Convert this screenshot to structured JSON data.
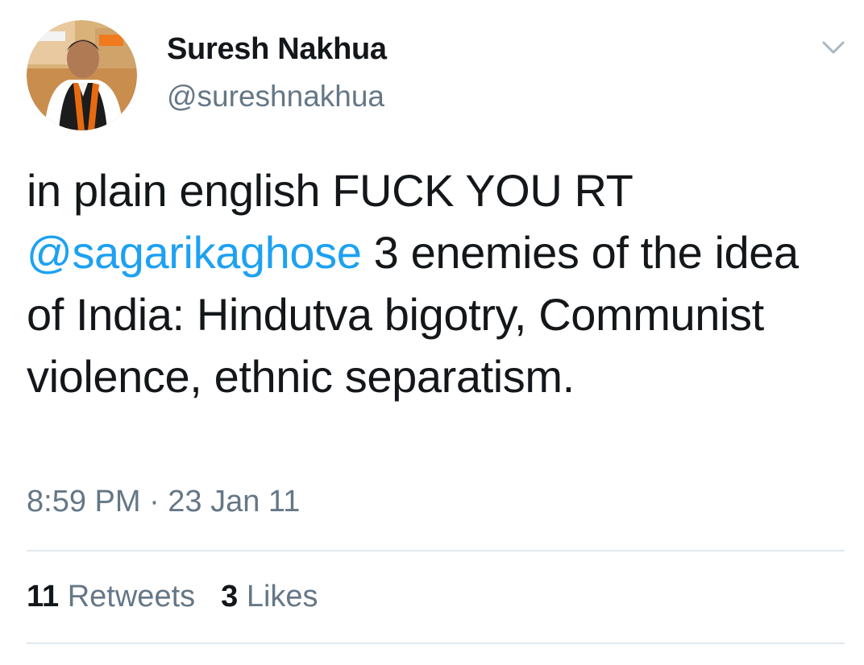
{
  "user": {
    "name": "Suresh Nakhua",
    "handle": "@sureshnakhua"
  },
  "tweet": {
    "text_before": "in plain english FUCK YOU RT",
    "mention": "@sagarikaghose",
    "text_after": "3 enemies of the idea of India: Hindutva bigotry, Communist violence, ethnic separatism.",
    "timestamp": "8:59 PM · 23 Jan 11"
  },
  "stats": {
    "retweets_count": "11",
    "retweets_label": "Retweets",
    "likes_count": "3",
    "likes_label": "Likes"
  },
  "icons": {
    "menu": "chevron-down-icon"
  },
  "colors": {
    "link": "#1da1f2",
    "secondary_text": "#657786",
    "primary_text": "#14171a",
    "divider": "#e1e8ed"
  }
}
